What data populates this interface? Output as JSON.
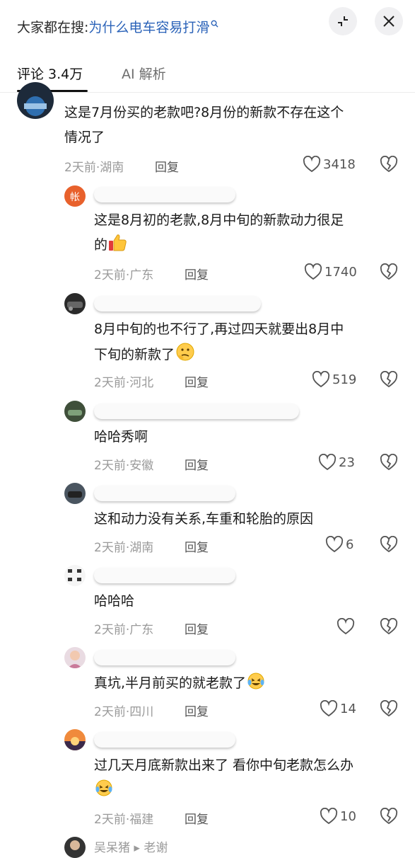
{
  "header": {
    "search_prefix": "大家都在搜:",
    "search_query": "为什么电车容易打滑",
    "tabs": [
      {
        "label": "评论 3.4万",
        "active": true
      },
      {
        "label": "AI 解析",
        "active": false
      }
    ]
  },
  "comments": [
    {
      "text_line1": "这是7月份买的老款吧?8月份的新款不存在这个",
      "text_line2": "情况了",
      "meta": "2天前·湖南",
      "reply": "回复",
      "likes": "3418"
    },
    {
      "text_line1": "这是8月初的老款,8月中旬的新款动力很足",
      "text_line2": "的",
      "emoji": "thumbs-up",
      "meta": "2天前·广东",
      "reply": "回复",
      "likes": "1740"
    },
    {
      "text_line1": "8月中旬的也不行了,再过四天就要出8月中",
      "text_line2": "下旬的新款了",
      "emoji": "thinking",
      "meta": "2天前·河北",
      "reply": "回复",
      "likes": "519"
    },
    {
      "text_line1": "哈哈秀啊",
      "meta": "2天前·安徽",
      "reply": "回复",
      "likes": "23"
    },
    {
      "text_line1": "这和动力没有关系,车重和轮胎的原因",
      "meta": "2天前·湖南",
      "reply": "回复",
      "likes": "6"
    },
    {
      "text_line1": "哈哈哈",
      "meta": "2天前·广东",
      "reply": "回复",
      "likes": ""
    },
    {
      "text_line1": "真坑,半月前买的就老款了",
      "emoji": "crying-laugh",
      "meta": "2天前·四川",
      "reply": "回复",
      "likes": "14"
    },
    {
      "text_line1": "过几天月底新款出来了 看你中旬老款怎么办",
      "emoji": "crying-laugh",
      "meta": "2天前·福建",
      "reply": "回复",
      "likes": "10"
    }
  ],
  "bottom_peek": "吴呆猪 ▸ 老谢",
  "colors": {
    "query": "#2a62b8",
    "meta": "#9a9a9a",
    "text": "#1a1a1a"
  }
}
